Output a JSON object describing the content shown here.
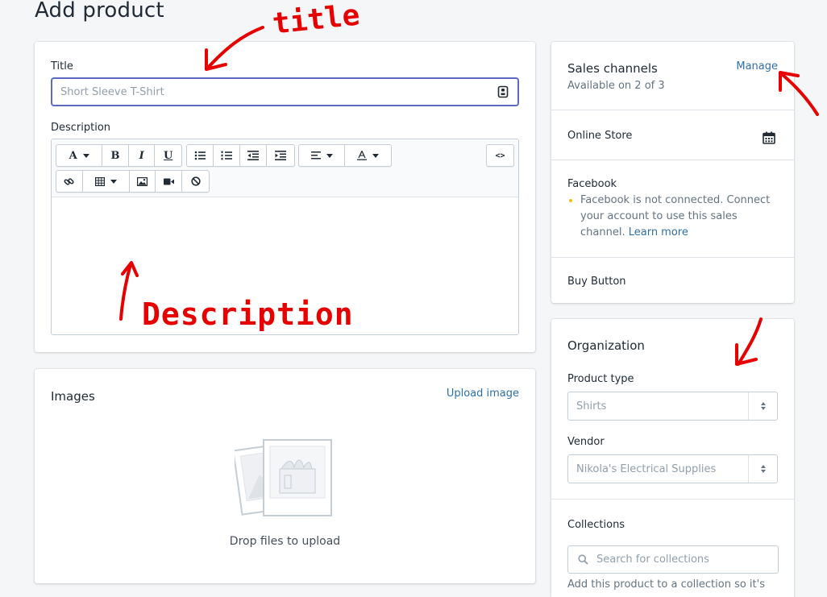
{
  "page": {
    "title": "Add product"
  },
  "product": {
    "title_label": "Title",
    "title_placeholder": "Short Sleeve T-Shirt",
    "description_label": "Description"
  },
  "editor": {
    "code_label": "<>",
    "bold": "B",
    "italic": "I",
    "underline": "U",
    "font_letter": "A"
  },
  "images": {
    "title": "Images",
    "upload_label": "Upload image",
    "drop_text": "Drop files to upload"
  },
  "sales_channels": {
    "title": "Sales channels",
    "subtitle": "Available on 2 of 3",
    "manage_label": "Manage",
    "online_store": "Online Store",
    "facebook": "Facebook",
    "facebook_note": "Facebook is not connected. Connect your account to use this sales channel.",
    "learn_more": "Learn more",
    "buy_button": "Buy Button"
  },
  "organization": {
    "title": "Organization",
    "product_type_label": "Product type",
    "product_type_value": "Shirts",
    "vendor_label": "Vendor",
    "vendor_value": "Nikola's Electrical Supplies",
    "collections_label": "Collections",
    "collections_placeholder": "Search for collections",
    "collections_help": "Add this product to a collection so it's"
  },
  "annotations": {
    "title_note": "title",
    "description_note": "Description"
  },
  "colors": {
    "accent": "#5c6ac4",
    "link": "#2f6fa7",
    "annotation": "#e60000",
    "warning_dot": "#eec200"
  }
}
